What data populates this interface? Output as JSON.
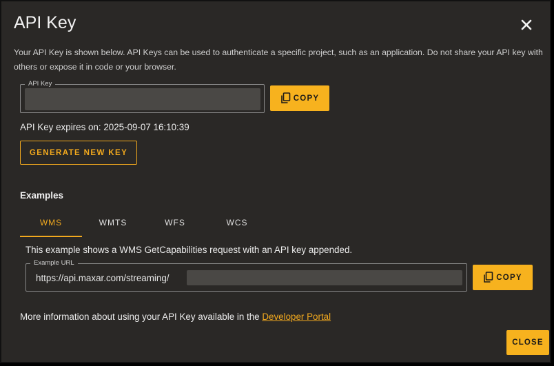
{
  "dialog": {
    "title": "API Key",
    "close_icon": "close-icon",
    "description": "Your API Key is shown below. API Keys can be used to authenticate a specific project, such as an application. Do not share your API key with others or expose it in code or your browser."
  },
  "api_key": {
    "legend": "API Key",
    "copy_label": "COPY",
    "copy_icon": "copy-icon",
    "expires_text": "API Key expires on: 2025-09-07 16:10:39",
    "generate_label": "GENERATE NEW KEY"
  },
  "examples": {
    "heading": "Examples",
    "tabs": [
      {
        "label": "WMS",
        "active": true
      },
      {
        "label": "WMTS",
        "active": false
      },
      {
        "label": "WFS",
        "active": false
      },
      {
        "label": "WCS",
        "active": false
      }
    ],
    "description": "This example shows a WMS GetCapabilities request with an API key appended.",
    "url_legend": "Example URL",
    "url_value": "https://api.maxar.com/streaming/",
    "copy_label": "COPY",
    "copy_icon": "copy-icon"
  },
  "footer": {
    "more_info": "More information about using your API Key available in the",
    "link_label": "Developer Portal",
    "close_label": "CLOSE"
  },
  "colors": {
    "accent": "#f7b21e",
    "background": "#2a2826",
    "masked_value": "#4a4845"
  }
}
